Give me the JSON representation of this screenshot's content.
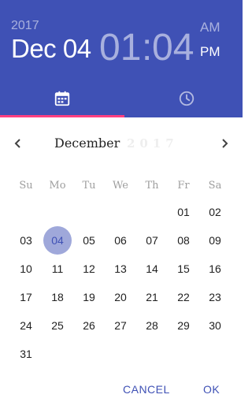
{
  "header": {
    "year": "2017",
    "date": "Dec 04",
    "hour": "01",
    "separator": ":",
    "minute": "04",
    "am": "AM",
    "pm": "PM",
    "active_period": "PM",
    "active_tab": "date",
    "color_header": "#3f51b5",
    "color_indicator": "#ff4081"
  },
  "tabs": [
    {
      "id": "date",
      "icon": "calendar-icon"
    },
    {
      "id": "time",
      "icon": "clock-icon"
    }
  ],
  "calendar": {
    "month": "December",
    "year_ghost": "2017",
    "prev_icon": "chevron-left-icon",
    "next_icon": "chevron-right-icon",
    "weekdays": [
      "Su",
      "Mo",
      "Tu",
      "We",
      "Th",
      "Fr",
      "Sa"
    ],
    "days": [
      [
        "",
        "",
        "",
        "",
        "",
        "01",
        "02"
      ],
      [
        "03",
        "04",
        "05",
        "06",
        "07",
        "08",
        "09"
      ],
      [
        "10",
        "11",
        "12",
        "13",
        "14",
        "15",
        "16"
      ],
      [
        "17",
        "18",
        "19",
        "20",
        "21",
        "22",
        "23"
      ],
      [
        "24",
        "25",
        "26",
        "27",
        "28",
        "29",
        "30"
      ],
      [
        "31",
        "",
        "",
        "",
        "",
        "",
        ""
      ]
    ],
    "selected_day": "04",
    "color_selected": "#9fa8da"
  },
  "actions": {
    "cancel": "CANCEL",
    "ok": "OK"
  }
}
